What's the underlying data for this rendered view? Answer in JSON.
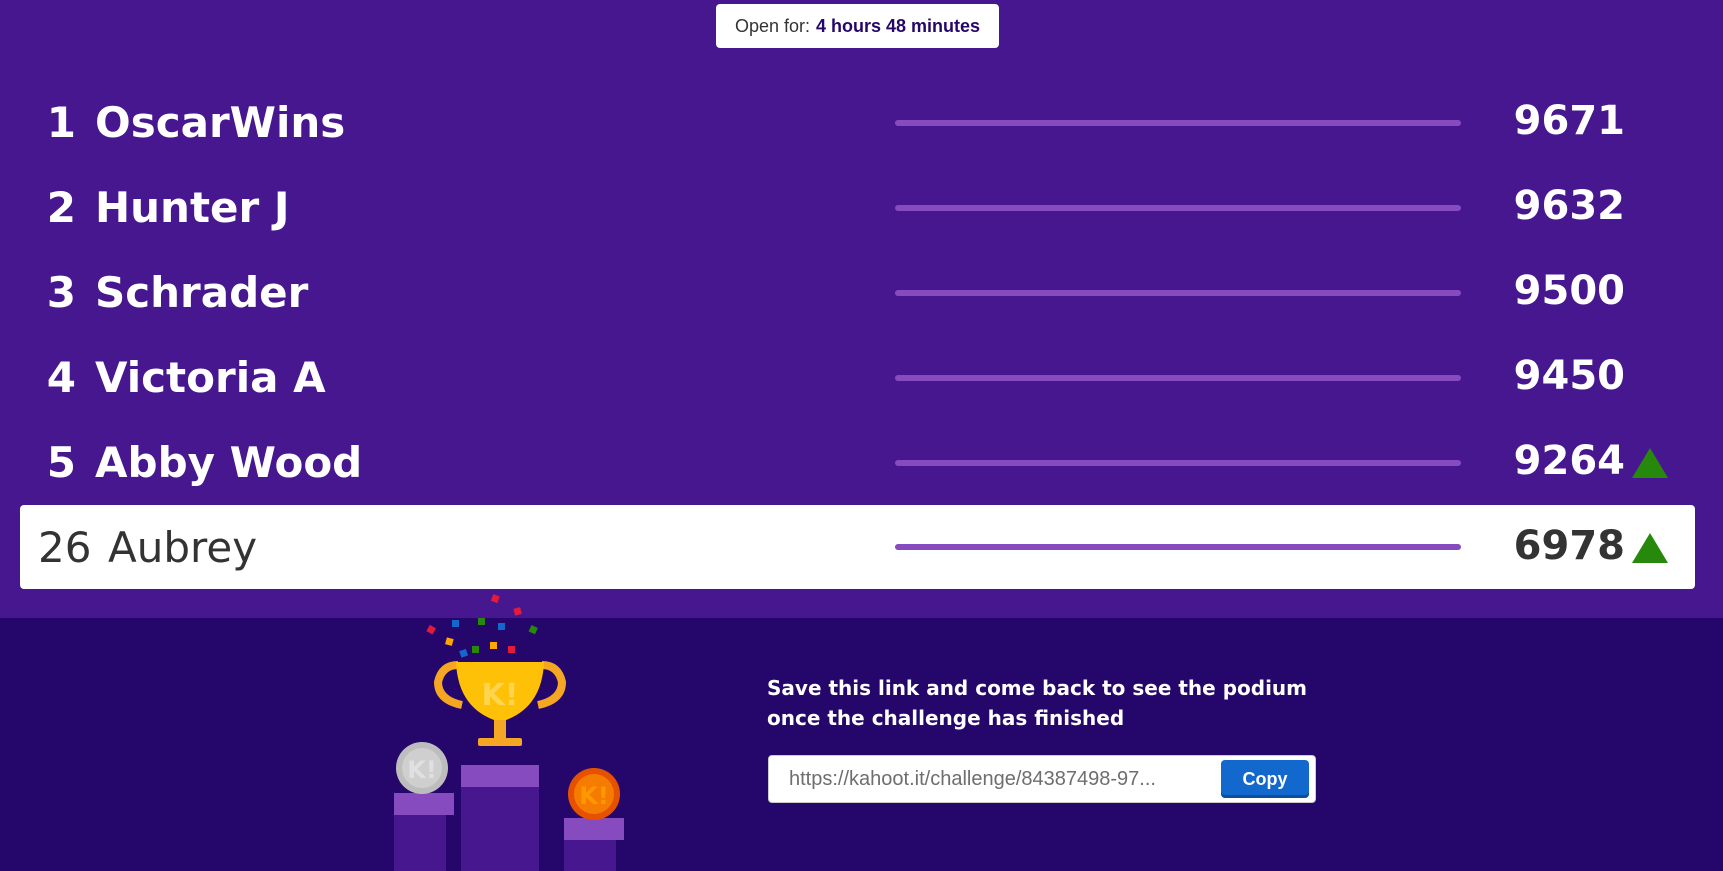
{
  "timer": {
    "label": "Open for:",
    "value": "4 hours 48 minutes"
  },
  "leaderboard": [
    {
      "rank": "1",
      "name": "OscarWins",
      "score": "9671",
      "trend_up": false
    },
    {
      "rank": "2",
      "name": "Hunter J",
      "score": "9632",
      "trend_up": false
    },
    {
      "rank": "3",
      "name": "Schrader",
      "score": "9500",
      "trend_up": false
    },
    {
      "rank": "4",
      "name": "Victoria A",
      "score": "9450",
      "trend_up": false
    },
    {
      "rank": "5",
      "name": "Abby Wood",
      "score": "9264",
      "trend_up": true
    }
  ],
  "current_player": {
    "rank": "26",
    "name": "Aubrey",
    "score": "6978",
    "trend_up": true
  },
  "footer": {
    "message": "Save this link and come back to see the podium once the challenge has finished",
    "link": "https://kahoot.it/challenge/84387498-97...",
    "copy_label": "Copy"
  },
  "colors": {
    "background": "#46178f",
    "footer": "#25076b",
    "bar": "#864cbf",
    "trend_up": "#26890c",
    "copy_button": "#1368ce"
  },
  "icons": [
    "trophy-icon",
    "silver-medal-icon",
    "bronze-medal-icon",
    "trend-up-arrow-icon"
  ]
}
